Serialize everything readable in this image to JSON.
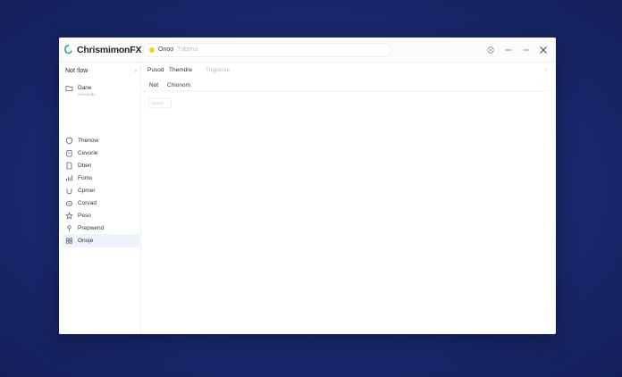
{
  "window": {
    "title": "ChrismimonFX",
    "tab": {
      "label": "Onoo",
      "hint": "Tnbimo"
    }
  },
  "sidebar": {
    "header": "Not !low",
    "header_chevron": "›",
    "items": [
      {
        "label": "Dane",
        "sub": "anonsodo",
        "icon": "folder-icon"
      },
      {
        "label": "Thenow",
        "icon": "shield-icon"
      },
      {
        "label": "Cevorie",
        "icon": "clipboard-icon"
      },
      {
        "label": "Dben",
        "icon": "document-icon"
      },
      {
        "label": "Foms",
        "icon": "chart-icon"
      },
      {
        "label": "Cpmer",
        "icon": "cup-icon"
      },
      {
        "label": "Corvad",
        "icon": "cloud-icon"
      },
      {
        "label": "Peso",
        "icon": "star-icon"
      },
      {
        "label": "Prepwend",
        "icon": "pin-icon"
      },
      {
        "label": "Onoje",
        "icon": "grid-icon",
        "active": true
      }
    ]
  },
  "main": {
    "breadcrumbs": [
      "Pusod",
      "Themdre",
      "Tngbenie"
    ],
    "chevron": "›",
    "subrow": {
      "label": "Not",
      "value": "Chionom",
      "end": "·"
    },
    "field_placeholder": "Nomo"
  },
  "colors": {
    "background": "#1b2b74",
    "logo_accent": "#2bb5a0",
    "tab_dot": "#f5d228",
    "active_item": "#eef2fb"
  }
}
